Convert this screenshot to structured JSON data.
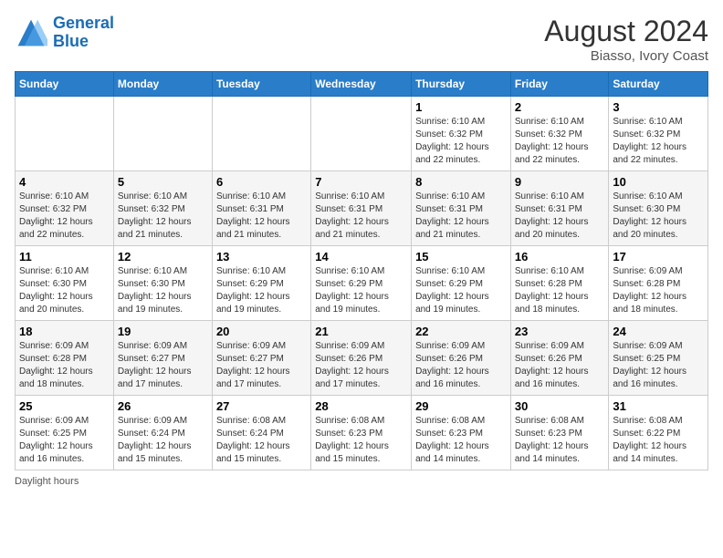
{
  "header": {
    "logo_line1": "General",
    "logo_line2": "Blue",
    "title": "August 2024",
    "subtitle": "Biasso, Ivory Coast"
  },
  "days_of_week": [
    "Sunday",
    "Monday",
    "Tuesday",
    "Wednesday",
    "Thursday",
    "Friday",
    "Saturday"
  ],
  "weeks": [
    [
      {
        "day": "",
        "info": ""
      },
      {
        "day": "",
        "info": ""
      },
      {
        "day": "",
        "info": ""
      },
      {
        "day": "",
        "info": ""
      },
      {
        "day": "1",
        "info": "Sunrise: 6:10 AM\nSunset: 6:32 PM\nDaylight: 12 hours\nand 22 minutes."
      },
      {
        "day": "2",
        "info": "Sunrise: 6:10 AM\nSunset: 6:32 PM\nDaylight: 12 hours\nand 22 minutes."
      },
      {
        "day": "3",
        "info": "Sunrise: 6:10 AM\nSunset: 6:32 PM\nDaylight: 12 hours\nand 22 minutes."
      }
    ],
    [
      {
        "day": "4",
        "info": "Sunrise: 6:10 AM\nSunset: 6:32 PM\nDaylight: 12 hours\nand 22 minutes."
      },
      {
        "day": "5",
        "info": "Sunrise: 6:10 AM\nSunset: 6:32 PM\nDaylight: 12 hours\nand 21 minutes."
      },
      {
        "day": "6",
        "info": "Sunrise: 6:10 AM\nSunset: 6:31 PM\nDaylight: 12 hours\nand 21 minutes."
      },
      {
        "day": "7",
        "info": "Sunrise: 6:10 AM\nSunset: 6:31 PM\nDaylight: 12 hours\nand 21 minutes."
      },
      {
        "day": "8",
        "info": "Sunrise: 6:10 AM\nSunset: 6:31 PM\nDaylight: 12 hours\nand 21 minutes."
      },
      {
        "day": "9",
        "info": "Sunrise: 6:10 AM\nSunset: 6:31 PM\nDaylight: 12 hours\nand 20 minutes."
      },
      {
        "day": "10",
        "info": "Sunrise: 6:10 AM\nSunset: 6:30 PM\nDaylight: 12 hours\nand 20 minutes."
      }
    ],
    [
      {
        "day": "11",
        "info": "Sunrise: 6:10 AM\nSunset: 6:30 PM\nDaylight: 12 hours\nand 20 minutes."
      },
      {
        "day": "12",
        "info": "Sunrise: 6:10 AM\nSunset: 6:30 PM\nDaylight: 12 hours\nand 19 minutes."
      },
      {
        "day": "13",
        "info": "Sunrise: 6:10 AM\nSunset: 6:29 PM\nDaylight: 12 hours\nand 19 minutes."
      },
      {
        "day": "14",
        "info": "Sunrise: 6:10 AM\nSunset: 6:29 PM\nDaylight: 12 hours\nand 19 minutes."
      },
      {
        "day": "15",
        "info": "Sunrise: 6:10 AM\nSunset: 6:29 PM\nDaylight: 12 hours\nand 19 minutes."
      },
      {
        "day": "16",
        "info": "Sunrise: 6:10 AM\nSunset: 6:28 PM\nDaylight: 12 hours\nand 18 minutes."
      },
      {
        "day": "17",
        "info": "Sunrise: 6:09 AM\nSunset: 6:28 PM\nDaylight: 12 hours\nand 18 minutes."
      }
    ],
    [
      {
        "day": "18",
        "info": "Sunrise: 6:09 AM\nSunset: 6:28 PM\nDaylight: 12 hours\nand 18 minutes."
      },
      {
        "day": "19",
        "info": "Sunrise: 6:09 AM\nSunset: 6:27 PM\nDaylight: 12 hours\nand 17 minutes."
      },
      {
        "day": "20",
        "info": "Sunrise: 6:09 AM\nSunset: 6:27 PM\nDaylight: 12 hours\nand 17 minutes."
      },
      {
        "day": "21",
        "info": "Sunrise: 6:09 AM\nSunset: 6:26 PM\nDaylight: 12 hours\nand 17 minutes."
      },
      {
        "day": "22",
        "info": "Sunrise: 6:09 AM\nSunset: 6:26 PM\nDaylight: 12 hours\nand 16 minutes."
      },
      {
        "day": "23",
        "info": "Sunrise: 6:09 AM\nSunset: 6:26 PM\nDaylight: 12 hours\nand 16 minutes."
      },
      {
        "day": "24",
        "info": "Sunrise: 6:09 AM\nSunset: 6:25 PM\nDaylight: 12 hours\nand 16 minutes."
      }
    ],
    [
      {
        "day": "25",
        "info": "Sunrise: 6:09 AM\nSunset: 6:25 PM\nDaylight: 12 hours\nand 16 minutes."
      },
      {
        "day": "26",
        "info": "Sunrise: 6:09 AM\nSunset: 6:24 PM\nDaylight: 12 hours\nand 15 minutes."
      },
      {
        "day": "27",
        "info": "Sunrise: 6:08 AM\nSunset: 6:24 PM\nDaylight: 12 hours\nand 15 minutes."
      },
      {
        "day": "28",
        "info": "Sunrise: 6:08 AM\nSunset: 6:23 PM\nDaylight: 12 hours\nand 15 minutes."
      },
      {
        "day": "29",
        "info": "Sunrise: 6:08 AM\nSunset: 6:23 PM\nDaylight: 12 hours\nand 14 minutes."
      },
      {
        "day": "30",
        "info": "Sunrise: 6:08 AM\nSunset: 6:23 PM\nDaylight: 12 hours\nand 14 minutes."
      },
      {
        "day": "31",
        "info": "Sunrise: 6:08 AM\nSunset: 6:22 PM\nDaylight: 12 hours\nand 14 minutes."
      }
    ]
  ],
  "footer": "Daylight hours"
}
